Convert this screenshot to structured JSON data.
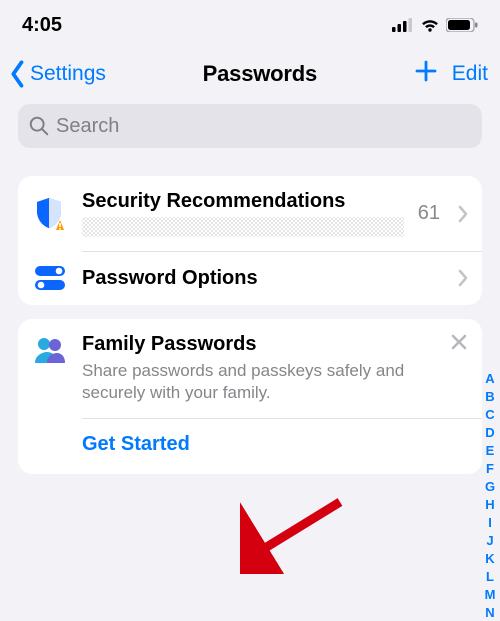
{
  "status": {
    "time": "4:05"
  },
  "nav": {
    "back": "Settings",
    "title": "Passwords",
    "edit": "Edit"
  },
  "search": {
    "placeholder": "Search"
  },
  "security": {
    "title": "Security Recommendations",
    "count": "61"
  },
  "options": {
    "title": "Password Options"
  },
  "family": {
    "title": "Family Passwords",
    "desc": "Share passwords and passkeys safely and securely with your family.",
    "cta": "Get Started"
  },
  "index": [
    "A",
    "B",
    "C",
    "D",
    "E",
    "F",
    "G",
    "H",
    "I",
    "J",
    "K",
    "L",
    "M",
    "N"
  ]
}
